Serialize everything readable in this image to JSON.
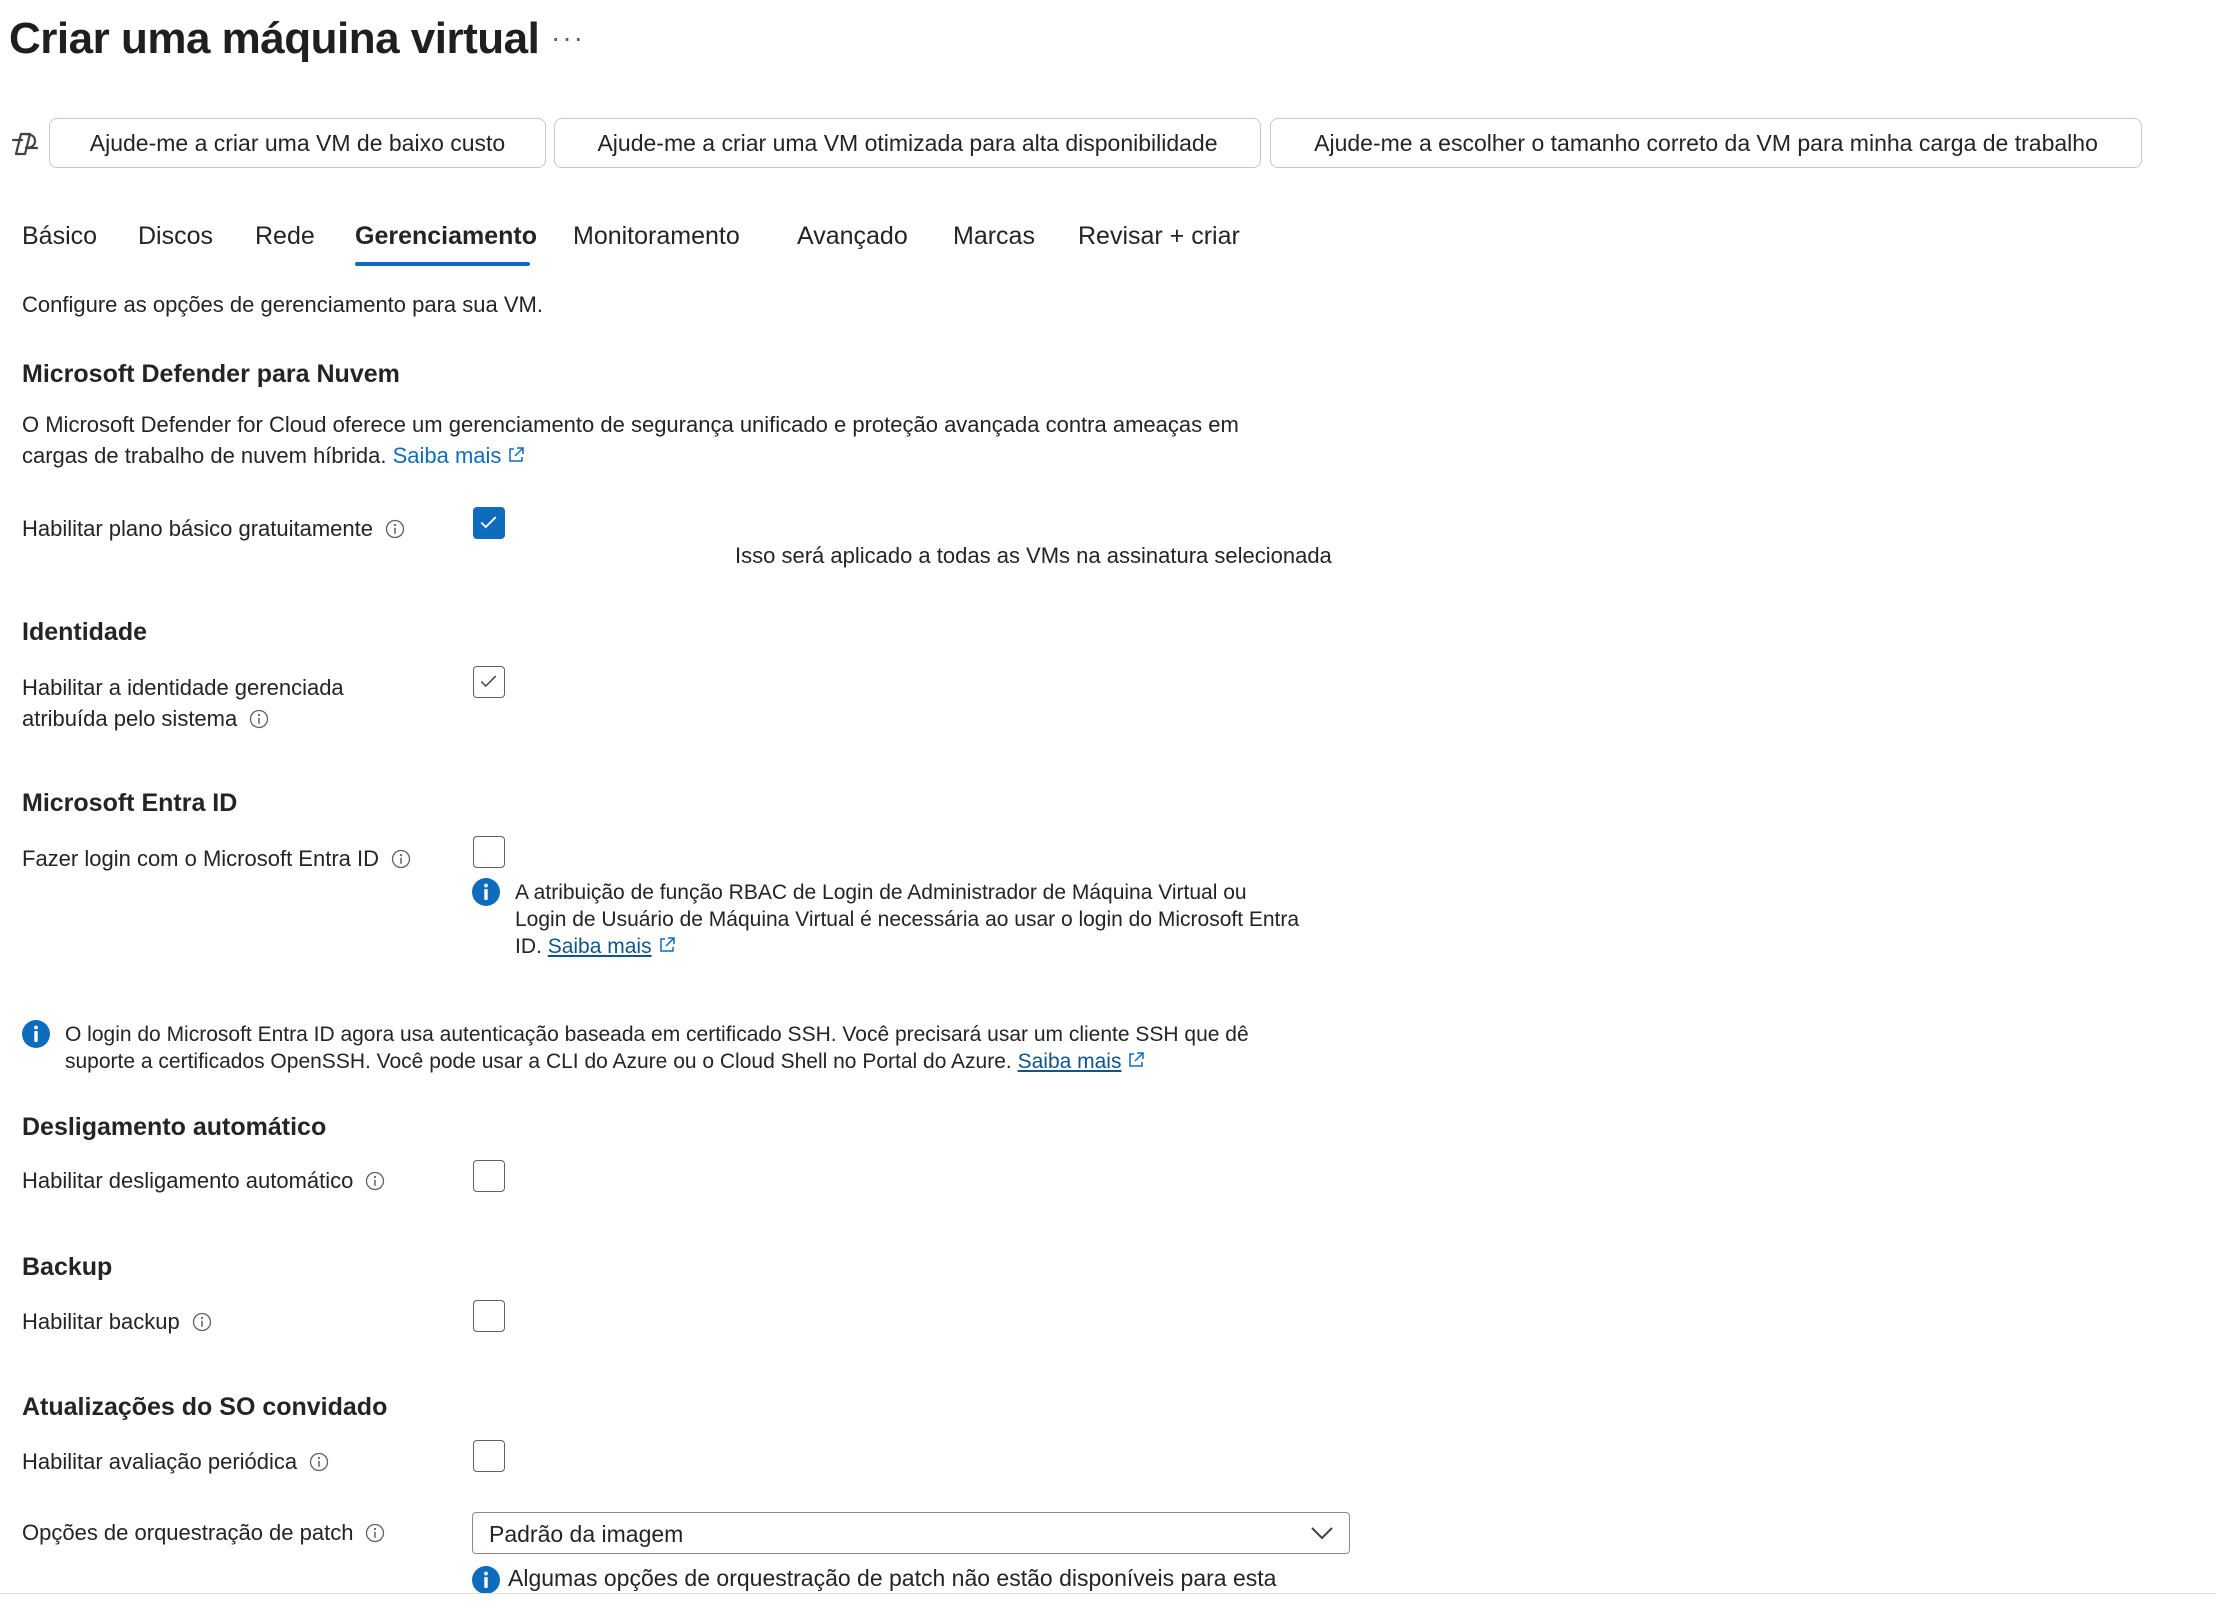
{
  "header": {
    "title": "Criar uma máquina virtual",
    "more_label": "···"
  },
  "copilot": {
    "icon": "copilot-icon",
    "chips": [
      "Ajude-me a criar uma VM de baixo custo",
      "Ajude-me a criar uma VM otimizada para alta disponibilidade",
      "Ajude-me a escolher o tamanho correto da VM para minha carga de trabalho"
    ]
  },
  "tabs": [
    {
      "label": "Básico"
    },
    {
      "label": "Discos"
    },
    {
      "label": "Rede"
    },
    {
      "label": "Gerenciamento",
      "active": true
    },
    {
      "label": "Monitoramento"
    },
    {
      "label": "Avançado"
    },
    {
      "label": "Marcas"
    },
    {
      "label": "Revisar + criar"
    }
  ],
  "intro": "Configure as opções de gerenciamento para sua VM.",
  "defender": {
    "heading": "Microsoft Defender para Nuvem",
    "desc_line1": "O Microsoft Defender for Cloud oferece um gerenciamento de segurança unificado e proteção avançada contra ameaças em",
    "desc_line2": "cargas de trabalho de nuvem híbrida.",
    "learn_more": "Saiba mais",
    "free_plan_label": "Habilitar plano básico gratuitamente",
    "free_plan_checked": true,
    "free_plan_note": "Isso será aplicado a todas as VMs na assinatura selecionada"
  },
  "identity": {
    "heading": "Identidade",
    "label_line1": "Habilitar a identidade gerenciada",
    "label_line2": "atribuída pelo sistema",
    "checked": true
  },
  "entra": {
    "heading": "Microsoft Entra ID",
    "login_label": "Fazer login com o Microsoft Entra ID",
    "login_checked": false,
    "rbac_line1": "A atribuição de função RBAC de Login de Administrador de Máquina Virtual ou",
    "rbac_line2": "Login de Usuário de Máquina Virtual é necessária ao usar o login do Microsoft Entra",
    "rbac_line3": "ID.",
    "rbac_learn_more": "Saiba mais",
    "ssh_line1": "O login do Microsoft Entra ID agora usa autenticação baseada em certificado SSH. Você precisará usar um cliente SSH que dê",
    "ssh_line2": "suporte a certificados OpenSSH. Você pode usar a CLI do Azure ou o Cloud Shell no Portal do Azure.",
    "ssh_learn_more": "Saiba mais"
  },
  "autoshutdown": {
    "heading": "Desligamento automático",
    "label": "Habilitar desligamento automático",
    "checked": false
  },
  "backup": {
    "heading": "Backup",
    "label": "Habilitar backup",
    "checked": false
  },
  "guest_updates": {
    "heading": "Atualizações do SO convidado",
    "periodic_label": "Habilitar avaliação periódica",
    "periodic_checked": false,
    "patch_label": "Opções de orquestração de patch",
    "patch_value": "Padrão da imagem",
    "patch_note": "Algumas opções de orquestração de patch não estão disponíveis para esta"
  },
  "colors": {
    "accent": "#0f6cbd",
    "text": "#242424",
    "border": "#c7c7c7"
  }
}
